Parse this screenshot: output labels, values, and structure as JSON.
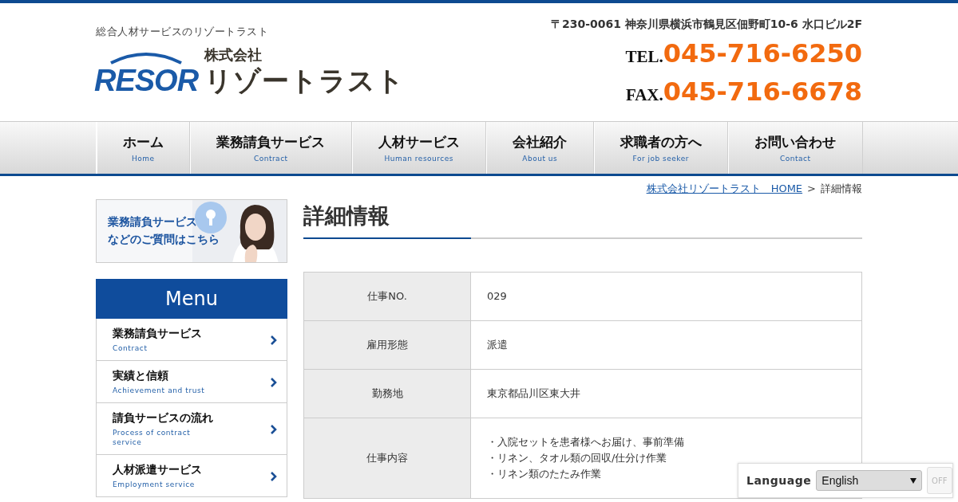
{
  "header": {
    "tagline": "総合人材サービスのリゾートラスト",
    "logo_mark": "RESOR",
    "company_prefix": "株式会社",
    "company_name": "リゾートラスト",
    "address": "〒230-0061 神奈川県横浜市鶴見区佃野町10-6 水口ビル2F",
    "tel_label": "TEL.",
    "tel": "045-716-6250",
    "fax_label": "FAX.",
    "fax": "045-716-6678"
  },
  "nav": [
    {
      "label": "ホーム",
      "sub": "Home"
    },
    {
      "label": "業務請負サービス",
      "sub": "Contract"
    },
    {
      "label": "人材サービス",
      "sub": "Human resources"
    },
    {
      "label": "会社紹介",
      "sub": "About us"
    },
    {
      "label": "求職者の方へ",
      "sub": "For job seeker"
    },
    {
      "label": "お問い合わせ",
      "sub": "Contact"
    }
  ],
  "breadcrumb": {
    "link": "株式会社リゾートラスト　HOME",
    "separator": ">",
    "current": "詳細情報"
  },
  "sidebar": {
    "banner": {
      "lines": [
        "業務請負サービス",
        "などのご質問はこちら"
      ],
      "kind": "picture"
    },
    "menu_title": "Menu",
    "items": [
      {
        "label": "業務請負サービス",
        "sub": "Contract"
      },
      {
        "label": "実績と信頼",
        "sub": "Achievement and trust"
      },
      {
        "label": "請負サービスの流れ",
        "sub": "Process of contract service"
      },
      {
        "label": "人材派遣サービス",
        "sub": "Employment service"
      }
    ]
  },
  "page_title": "詳細情報",
  "table": {
    "rows": [
      {
        "label": "仕事NO.",
        "lines": [
          "029"
        ]
      },
      {
        "label": "雇用形態",
        "lines": [
          "派遣"
        ]
      },
      {
        "label": "勤務地",
        "lines": [
          "東京都品川区東大井"
        ]
      },
      {
        "label": "仕事内容",
        "lines": [
          "・入院セットを患者様へお届け、事前準備",
          "・リネン、タオル類の回収/仕分け作業",
          "・リネン類のたたみ作業"
        ]
      }
    ]
  },
  "language": {
    "label": "Language",
    "value": "English",
    "toggle": "OFF"
  }
}
